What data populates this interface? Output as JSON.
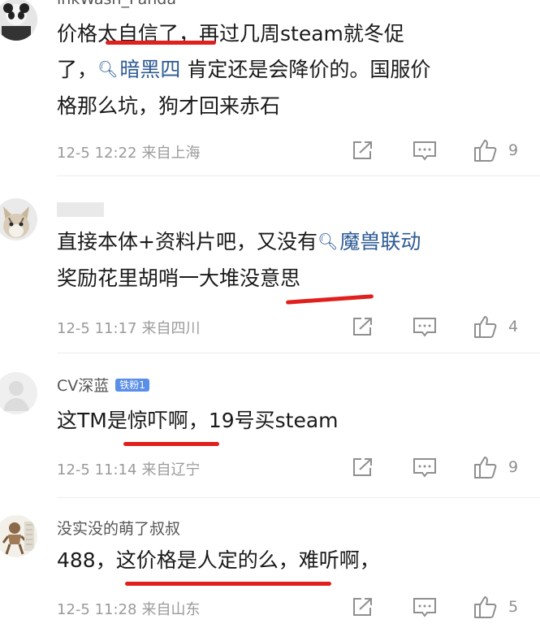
{
  "comments": [
    {
      "name": "inkWash_Panda",
      "content": {
        "line1": "价格太自信了，再过几周steam就冬促",
        "line2_pre": "了，",
        "line2_topic": "暗黑四",
        "line2_post": " 肯定还是会降价的。国服价",
        "line3": "格那么坑，狗才回来赤石"
      },
      "time": "12-5 12:22",
      "location": "来自上海",
      "likes": "9"
    },
    {
      "name": "",
      "content": {
        "line1_pre": "直接本体+资料片吧，又没有",
        "line1_topic": "魔兽联动",
        "line2": "奖励花里胡哨一大堆没意思"
      },
      "time": "12-5 11:17",
      "location": "来自四川",
      "likes": "4"
    },
    {
      "name": "CV深蓝",
      "badge": "铁粉1",
      "content": {
        "line1": "这TM是惊吓啊，19号买steam"
      },
      "time": "12-5 11:14",
      "location": "来自辽宁",
      "likes": "9"
    },
    {
      "name": "没实没的萌了叔叔",
      "content": {
        "line1": "488，这价格是人定的么，难听啊，"
      },
      "time": "12-5 11:28",
      "location": "来自山东",
      "likes": "5"
    }
  ],
  "colors": {
    "topic": "#2e5b94",
    "annotation": "#e0201c",
    "meta": "#9a9a9a"
  },
  "icons": [
    "share-icon",
    "comment-icon",
    "like-icon",
    "search-icon"
  ]
}
